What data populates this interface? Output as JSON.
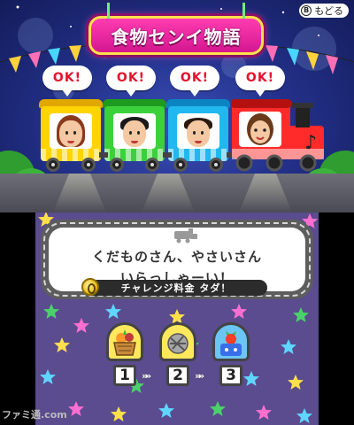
{
  "top_screen": {
    "title": "食物センイ物語",
    "back_button": {
      "key": "B",
      "label": "もどる"
    },
    "speech_bubbles": [
      "OK!",
      "OK!",
      "OK!",
      "OK!"
    ],
    "cars": [
      {
        "color": "#ffd400",
        "accent": "#e0a800",
        "avatar": "woman-auburn-hair"
      },
      {
        "color": "#3bd13b",
        "accent": "#1e9a1e",
        "avatar": "man-black-hair"
      },
      {
        "color": "#21b8f0",
        "accent": "#0d84c2",
        "avatar": "man-short-hair"
      },
      {
        "color": "#ff2b2b",
        "accent": "#b51010",
        "avatar": "woman-brown-hair",
        "music_note": "♪"
      }
    ]
  },
  "bottom_screen": {
    "message": {
      "line1": "くだものさん、やさいさん",
      "line2": "いらっしゃーい！"
    },
    "fee_label": "チャレンジ料金 タダ！",
    "steps": [
      {
        "number": "1",
        "icon": "fruit-basket-icon",
        "bg": "#ffe85c"
      },
      {
        "number": "2",
        "icon": "grinder-icon",
        "bg": "#ffe85c"
      },
      {
        "number": "3",
        "icon": "tomato-character-icon",
        "bg": "#6cc6f5"
      }
    ],
    "step_arrows": [
      "»»",
      "»»"
    ]
  },
  "watermark": "ファミ通.com",
  "colors": {
    "title_pink": "#e0249b",
    "title_border": "#ffe04a",
    "ok_red": "#e3132b",
    "stars_bg": "#5a4c8e"
  }
}
